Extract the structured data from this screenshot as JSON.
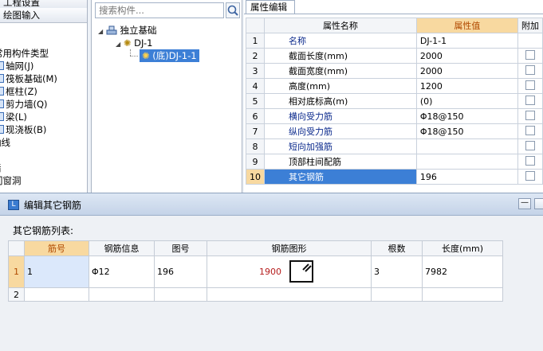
{
  "left_panel": {
    "tabs": [
      "工程设置",
      "绘图输入"
    ],
    "items": [
      {
        "label": "常用构件类型",
        "icon": ""
      },
      {
        "label": "轴网(J)",
        "icon": "grid-icon"
      },
      {
        "label": "筏板基础(M)",
        "icon": "raft-icon"
      },
      {
        "label": "框柱(Z)",
        "icon": "column-icon"
      },
      {
        "label": "剪力墙(Q)",
        "icon": "wall-icon"
      },
      {
        "label": "梁(L)",
        "icon": "beam-icon"
      },
      {
        "label": "现浇板(B)",
        "icon": "slab-icon"
      },
      {
        "label": "轴线",
        "icon": ""
      },
      {
        "label": "墙",
        "icon": ""
      },
      {
        "label": "门窗洞",
        "icon": ""
      }
    ]
  },
  "tree": {
    "search_placeholder": "搜索构件...",
    "root": "独立基础",
    "child": "DJ-1",
    "leaf": "(底)DJ-1-1"
  },
  "properties": {
    "tab": "属性编辑",
    "headers": [
      "属性名称",
      "属性值",
      "附加"
    ],
    "rows": [
      {
        "num": "1",
        "name": "名称",
        "value": "DJ-1-1",
        "blue": true,
        "check": false
      },
      {
        "num": "2",
        "name": "截面长度(mm)",
        "value": "2000",
        "blue": false,
        "check": true
      },
      {
        "num": "3",
        "name": "截面宽度(mm)",
        "value": "2000",
        "blue": false,
        "check": true
      },
      {
        "num": "4",
        "name": "高度(mm)",
        "value": "1200",
        "blue": false,
        "check": true
      },
      {
        "num": "5",
        "name": "相对底标高(m)",
        "value": "(0)",
        "blue": false,
        "check": true
      },
      {
        "num": "6",
        "name": "横向受力筋",
        "value": "Φ18@150",
        "blue": true,
        "check": true
      },
      {
        "num": "7",
        "name": "纵向受力筋",
        "value": "Φ18@150",
        "blue": true,
        "check": true
      },
      {
        "num": "8",
        "name": "短向加强筋",
        "value": "",
        "blue": true,
        "check": true
      },
      {
        "num": "9",
        "name": "顶部柱间配筋",
        "value": "",
        "blue": false,
        "check": true
      },
      {
        "num": "10",
        "name": "其它钢筋",
        "value": "196",
        "blue": false,
        "check": true,
        "selected": true
      }
    ]
  },
  "dialog": {
    "title": "编辑其它钢筋",
    "minimize_label": "—",
    "list_label": "其它钢筋列表:",
    "headers": [
      "筋号",
      "钢筋信息",
      "图号",
      "钢筋图形",
      "根数",
      "长度(mm)"
    ],
    "rows": [
      {
        "num": "1",
        "bar_no": "1",
        "info": "Φ12",
        "fig_no": "196",
        "shape_value": "1900",
        "count": "3",
        "length": "7982"
      },
      {
        "num": "2",
        "bar_no": "",
        "info": "",
        "fig_no": "",
        "shape_value": "",
        "count": "",
        "length": ""
      }
    ]
  },
  "colors": {
    "accent_header": "#f8d9a0",
    "selection": "#3c7fd6",
    "blue_text": "#0c2b8d",
    "shape_value": "#b51c1c"
  }
}
